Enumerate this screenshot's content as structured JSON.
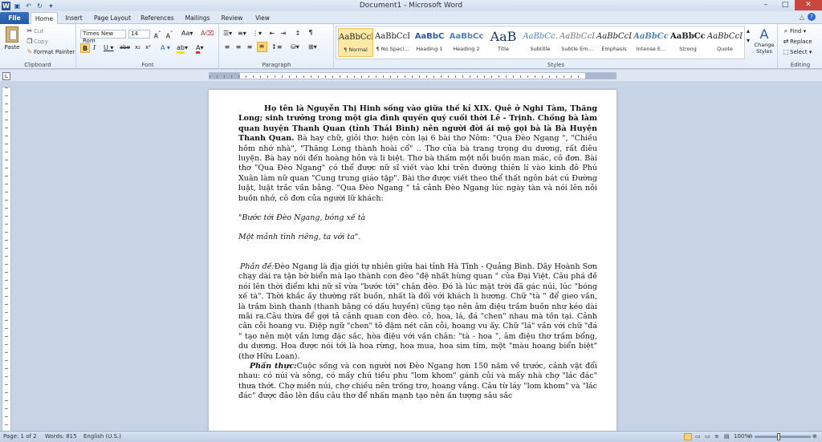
{
  "window": {
    "title": "Document1 - Microsoft Word",
    "minimize": "–",
    "maximize": "□",
    "close": "✕"
  },
  "tabs": [
    "File",
    "Home",
    "Insert",
    "Page Layout",
    "References",
    "Mailings",
    "Review",
    "View"
  ],
  "clipboard": {
    "paste": "Paste",
    "cut": "Cut",
    "copy": "Copy",
    "format_painter": "Format Painter",
    "label": "Clipboard"
  },
  "font": {
    "name": "Times New Rom",
    "size": "14",
    "label": "Font"
  },
  "paragraph": {
    "label": "Paragraph"
  },
  "styles": {
    "label": "Styles",
    "change": "Change Styles",
    "items": [
      {
        "preview": "AaBbCcI",
        "name": "¶ Normal"
      },
      {
        "preview": "AaBbCcI",
        "name": "¶ No Spaci..."
      },
      {
        "preview": "AaBbC",
        "name": "Heading 1"
      },
      {
        "preview": "AaBbCc",
        "name": "Heading 2"
      },
      {
        "preview": "AaB",
        "name": "Title"
      },
      {
        "preview": "AaBbCc.",
        "name": "Subtitle"
      },
      {
        "preview": "AaBbCcL",
        "name": "Subtle Em..."
      },
      {
        "preview": "AaBbCcL",
        "name": "Emphasis"
      },
      {
        "preview": "AaBbCc",
        "name": "Intense E..."
      },
      {
        "preview": "AaBbCcl",
        "name": "Strong"
      },
      {
        "preview": "AaBbCcI",
        "name": "Quote"
      }
    ]
  },
  "editing": {
    "find": "Find",
    "replace": "Replace",
    "select": "Select",
    "label": "Editing"
  },
  "document": {
    "p1_bold": "Họ tên là Nguyễn Thị Hinh sống vào giữa thế kỉ XIX. Quê ở Nghi Tàm, Thăng Long; sinh trưởng trong một gia đình quyền quý cuối thời Lê - Trịnh. Chồng bà làm quan huyện Thanh Quan (tỉnh Thái Bình) nên người đời ái mộ gọi bà là Bà Huyện Thanh Quan.",
    "p1_rest": " Bà hay chữ, giỏi thơ: hiện còn lại 6 bài thơ Nôm: \"Qua Đèo Ngang \", \"Chiều hôm nhớ nhà\", \"Thăng Long thành hoài cổ\" .. Thơ của bà trang trọng du dương, rất điêu luyện. Bà hay nói đến hoàng hôn và li biệt. Thơ bà thấm một nỗi buồn man mác, cô đơn. Bài thơ \"Qua Đèo Ngang\" có thể được nữ sĩ viết vào khi trên đường thiên lí vào kinh đô Phú Xuân làm nữ quan \"Cung trung giáo tập\". Bài thơ được viết theo thể thất ngôn bát cú Đường luật, luật trắc vần bằng. \"Qua Đèo Ngang \" tả cảnh Đèo Ngang lúc ngày tàn và nói lên nỗi buồn nhớ, cô đơn của người lữ khách:",
    "quote1": "\"Bước tới Đèo Ngang, bóng xế tà",
    "quote2": "Một mảnh tình riêng, ta với ta\".",
    "p2_label": "Phần đề:",
    "p2_text": "Đèo Ngang là địa giới tự nhiên giữa hai tỉnh Hà Tĩnh - Quảng Bình. Dãy Hoành Sơn chạy dài ra tận bờ biển mà lạo thành con đèo \"đệ nhất hùng quan \" của Đại Việt. Câu phá đề nói lên thời điểm khi nữ sĩ vừa \"bước tới\" chân đèo. Đó là lúc mặt trời đã gác núi, lúc \"bóng xế tà\". Thời khắc ấy thường rất buồn, nhất là đối với khách li hương. Chữ \"tà \" để gieo vần, là trầm bình thanh (thanh bằng có dấu huyền) cũng tạo nên âm điệu trầm buồn như kéo dài mãi ra.Câu thừa để gợi tả cảnh quan con đèo. cỏ, hoa, lá, đá \"chen\" nhau mà tồn tại. Cảnh cằn cỗi hoang vu. Điệp ngữ \"chen\" tô đậm nét cằn cỗi, hoang vu ấy. Chữ \"lá\" vần với chữ \"đá \" tạo nên một vần lưng đặc sắc, hòa điệu với vần chân: \"tà - hoa \", âm điệu thơ trầm bổng, du dương. Hoa được nói tới là hoa rừng, hoa mua, hoa sim tím, một \"màu hoang biển biệt\" (thơ Hữu Loan).",
    "p3_label": "Phần thực:",
    "p3_text": "Cuộc sống và con người nơi Đèo Ngang hơn 150 năm về trước, cảnh vật đổi nhau: có núi và sông, có mấy chú tiều phu \"lom khom\" gánh củi và mấy nhà chợ \"lác đác\" thưa thớt. Chợ miền núi, chợ chiều nên trống trơ, hoang vắng. Câu từ láy \"lom khom\" và \"lác đác\" được đảo lên đầu câu thơ để nhấn mạnh tạo nên ấn tượng sâu sắc"
  },
  "status": {
    "page": "Page: 1 of 2",
    "words": "Words: 815",
    "language": "English (U.S.)",
    "zoom": "100%",
    "zoom_value": 100
  }
}
